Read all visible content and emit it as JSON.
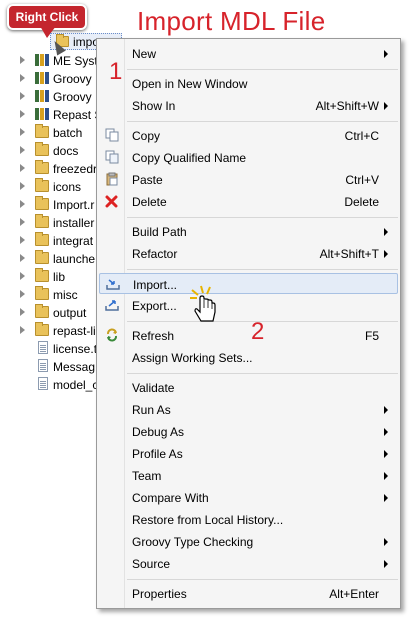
{
  "callout": {
    "text": "Right Click"
  },
  "heading": "Import MDL File",
  "steps": {
    "one": "1",
    "two": "2"
  },
  "tree": {
    "selected_label": "impo",
    "items": [
      {
        "label": "ME Syst",
        "icon": "project-icon"
      },
      {
        "label": "Groovy",
        "icon": "project-icon"
      },
      {
        "label": "Groovy",
        "icon": "project-icon"
      },
      {
        "label": "Repast S",
        "icon": "project-icon"
      },
      {
        "label": "batch",
        "icon": "folder-icon"
      },
      {
        "label": "docs",
        "icon": "folder-icon"
      },
      {
        "label": "freezedr",
        "icon": "folder-icon"
      },
      {
        "label": "icons",
        "icon": "folder-icon"
      },
      {
        "label": "Import.r",
        "icon": "folder-icon"
      },
      {
        "label": "installer",
        "icon": "folder-icon"
      },
      {
        "label": "integrat",
        "icon": "folder-icon"
      },
      {
        "label": "launche",
        "icon": "folder-icon"
      },
      {
        "label": "lib",
        "icon": "folder-icon"
      },
      {
        "label": "misc",
        "icon": "folder-icon"
      },
      {
        "label": "output",
        "icon": "folder-icon"
      },
      {
        "label": "repast-li",
        "icon": "folder-icon"
      },
      {
        "label": "license.t",
        "icon": "file-icon"
      },
      {
        "label": "Messag",
        "icon": "file-icon"
      },
      {
        "label": "model_c",
        "icon": "file-icon"
      }
    ]
  },
  "menu": {
    "new": "New",
    "open_window": "Open in New Window",
    "show_in": "Show In",
    "show_in_sc": "Alt+Shift+W",
    "copy": "Copy",
    "copy_sc": "Ctrl+C",
    "copy_qualified": "Copy Qualified Name",
    "paste": "Paste",
    "paste_sc": "Ctrl+V",
    "delete": "Delete",
    "delete_sc": "Delete",
    "build_path": "Build Path",
    "refactor": "Refactor",
    "refactor_sc": "Alt+Shift+T",
    "import": "Import...",
    "export": "Export...",
    "refresh": "Refresh",
    "refresh_sc": "F5",
    "assign_ws": "Assign Working Sets...",
    "validate": "Validate",
    "run_as": "Run As",
    "debug_as": "Debug As",
    "profile_as": "Profile As",
    "team": "Team",
    "compare_with": "Compare With",
    "restore": "Restore from Local History...",
    "groovy_tc": "Groovy Type Checking",
    "source": "Source",
    "properties": "Properties",
    "properties_sc": "Alt+Enter"
  },
  "colors": {
    "accent_red": "#d7232b",
    "callout_red": "#c4262e",
    "highlight": "#e4ecf7"
  }
}
